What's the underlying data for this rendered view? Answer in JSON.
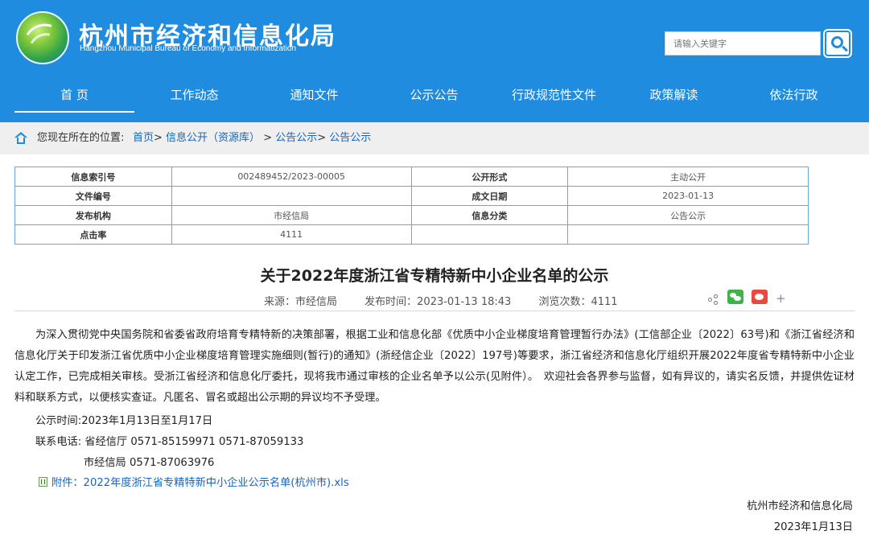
{
  "header": {
    "title": "杭州市经济和信息化局",
    "subtitle": "Hangzhou Municipal Bureau of Economy and Informatization",
    "search_placeholder": "请输入关键字"
  },
  "nav": [
    "首 页",
    "工作动态",
    "通知文件",
    "公示公告",
    "行政规范性文件",
    "政策解读",
    "依法行政"
  ],
  "breadcrumb": {
    "prefix": "您现在所在的位置:",
    "links": [
      "首页",
      "信息公开（资源库）",
      "公告公示",
      "公告公示"
    ],
    "sep": "> "
  },
  "meta": {
    "index_label": "信息索引号",
    "index_value": "002489452/2023-00005",
    "open_form_label": "公开形式",
    "open_form_value": "主动公开",
    "doc_no_label": "文件编号",
    "doc_no_value": "",
    "date_label": "成文日期",
    "date_value": "2023-01-13",
    "org_label": "发布机构",
    "org_value": "市经信局",
    "category_label": "信息分类",
    "category_value": "公告公示",
    "clicks_label": "点击率",
    "clicks_value": "4111"
  },
  "article": {
    "title": "关于2022年度浙江省专精特新中小企业名单的公示",
    "source": "来源：市经信局",
    "published": "发布时间：2023-01-13 18:43",
    "views": "浏览次数：4111",
    "body": "为深入贯彻党中央国务院和省委省政府培育专精特新的决策部署，根据工业和信息化部《优质中小企业梯度培育管理暂行办法》(工信部企业〔2022〕63号)和《浙江省经济和信息化厅关于印发浙江省优质中小企业梯度培育管理实施细则(暂行)的通知》(浙经信企业〔2022〕197号)等要求，浙江省经济和信息化厅组织开展2022年度省专精特新中小企业认定工作，已完成相关审核。受浙江省经济和信息化厅委托，现将我市通过审核的企业名单予以公示(见附件）。　欢迎社会各界参与监督，如有异议的，请实名反馈，并提供佐证材料和联系方式，以便核实查证。凡匿名、冒名或超出公示期的异议均不予受理。",
    "period": "公示时间:2023年1月13日至1月17日",
    "contact": "联系电话: 省经信厅 0571-85159971 0571-87059133",
    "contact2": "市经信局 0571-87063976",
    "attachment": "附件：2022年度浙江省专精特新中小企业公示名单(杭州市).xls",
    "signature": "杭州市经济和信息化局",
    "sign_date": "2023年1月13日"
  }
}
